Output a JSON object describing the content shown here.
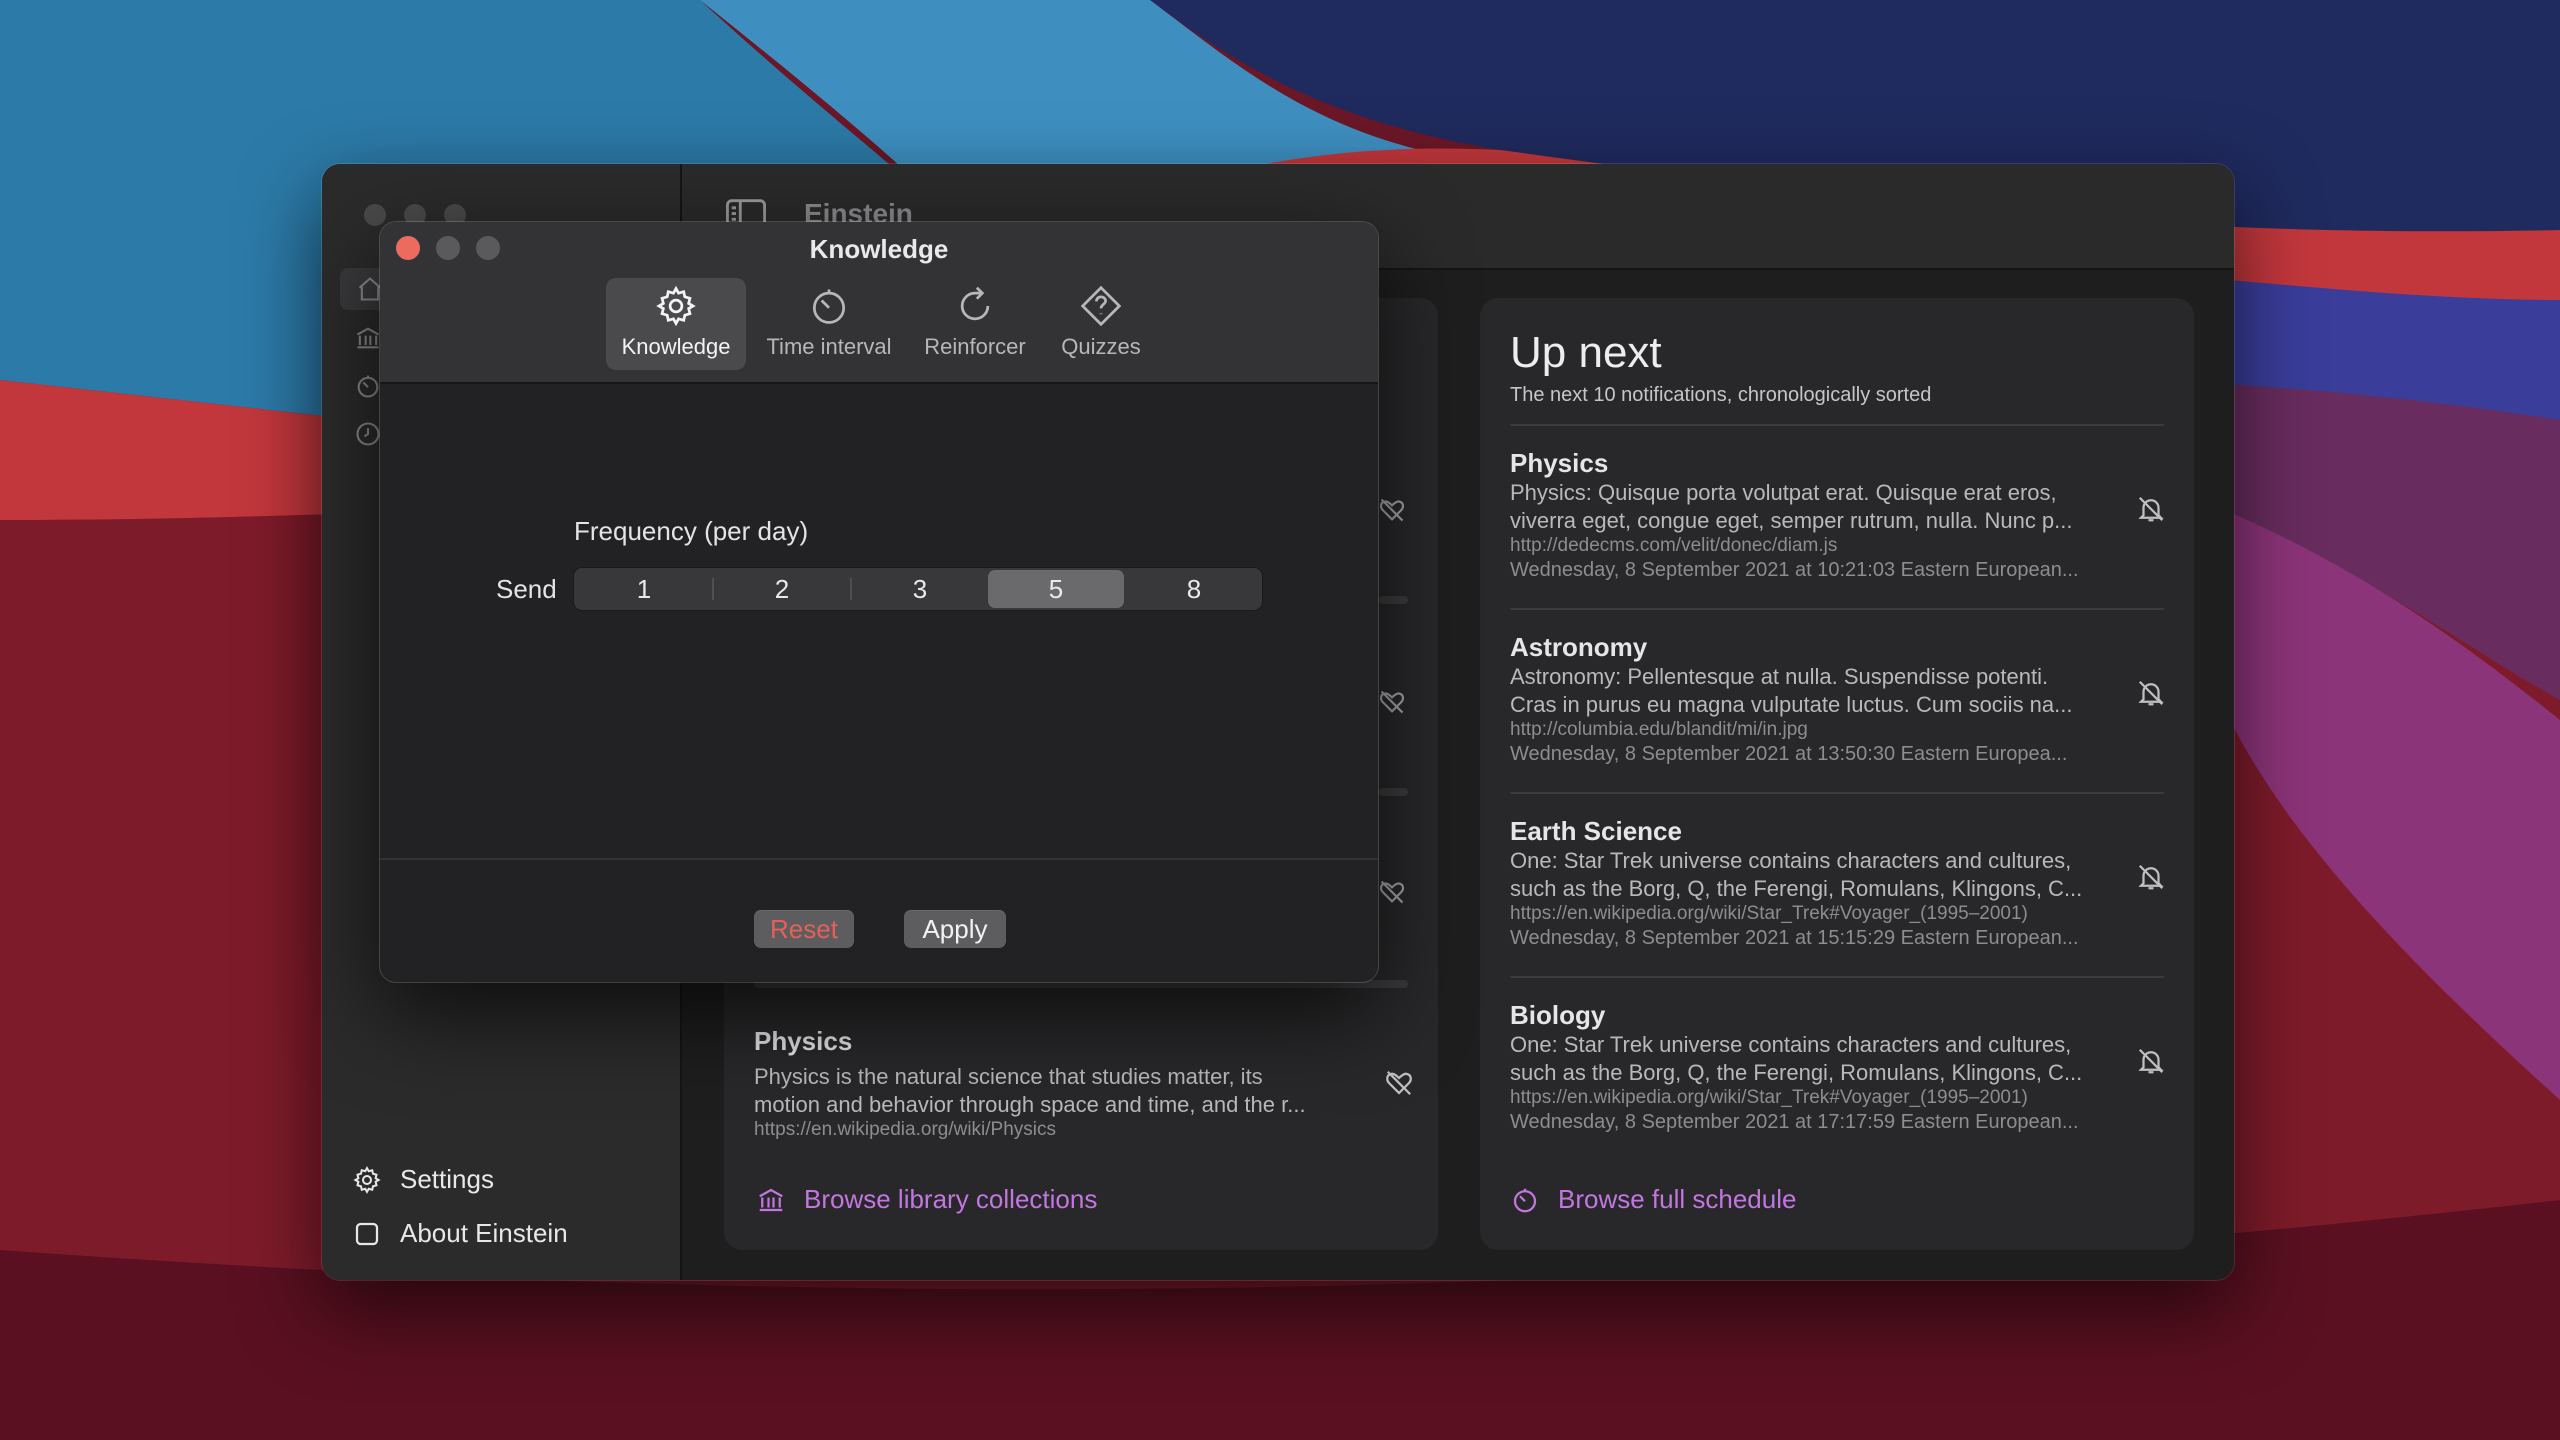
{
  "main_window": {
    "title": "Einstein",
    "sidebar": {
      "nav_icons": [
        "home-icon",
        "library-icon",
        "timer-icon",
        "history-icon"
      ],
      "settings_label": "Settings",
      "about_label": "About Einstein"
    },
    "library": {
      "visible_item": {
        "title": "Physics",
        "body_line1": "Physics is the natural science that studies matter, its",
        "body_line2": "motion and behavior through space and time, and the r...",
        "url": "https://en.wikipedia.org/wiki/Physics"
      },
      "browse_label": "Browse library collections"
    },
    "up_next": {
      "title": "Up next",
      "subtitle": "The next 10 notifications, chronologically sorted",
      "items": [
        {
          "title": "Physics",
          "line1": "Physics: Quisque porta volutpat erat. Quisque erat eros,",
          "line2": "viverra eget, congue eget, semper rutrum, nulla. Nunc p...",
          "url": "http://dedecms.com/velit/donec/diam.js",
          "date": "Wednesday, 8 September 2021 at 10:21:03 Eastern European..."
        },
        {
          "title": "Astronomy",
          "line1": "Astronomy: Pellentesque at nulla. Suspendisse potenti.",
          "line2": "Cras in purus eu magna vulputate luctus. Cum sociis na...",
          "url": "http://columbia.edu/blandit/mi/in.jpg",
          "date": "Wednesday, 8 September 2021 at 13:50:30 Eastern Europea..."
        },
        {
          "title": "Earth Science",
          "line1": "One: Star Trek universe contains characters and cultures,",
          "line2": "such as the Borg, Q, the Ferengi, Romulans, Klingons, C...",
          "url": "https://en.wikipedia.org/wiki/Star_Trek#Voyager_(1995–2001)",
          "date": "Wednesday, 8 September 2021 at 15:15:29 Eastern European..."
        },
        {
          "title": "Biology",
          "line1": "One: Star Trek universe contains characters and cultures,",
          "line2": "such as the Borg, Q, the Ferengi, Romulans, Klingons, C...",
          "url": "https://en.wikipedia.org/wiki/Star_Trek#Voyager_(1995–2001)",
          "date": "Wednesday, 8 September 2021 at 17:17:59 Eastern European..."
        }
      ],
      "browse_label": "Browse full schedule"
    }
  },
  "dialog": {
    "title": "Knowledge",
    "tabs": [
      {
        "label": "Knowledge",
        "icon": "gear-icon",
        "active": true
      },
      {
        "label": "Time interval",
        "icon": "timer-icon",
        "active": false
      },
      {
        "label": "Reinforcer",
        "icon": "refresh-icon",
        "active": false
      },
      {
        "label": "Quizzes",
        "icon": "question-diamond-icon",
        "active": false
      }
    ],
    "frequency_label": "Frequency (per day)",
    "send_label": "Send",
    "options": [
      "1",
      "2",
      "3",
      "5",
      "8"
    ],
    "selected_option": "5",
    "reset_label": "Reset",
    "apply_label": "Apply"
  },
  "colors": {
    "accent": "#c376e0",
    "close": "#ed6a5e",
    "reset_text": "#e56058"
  }
}
